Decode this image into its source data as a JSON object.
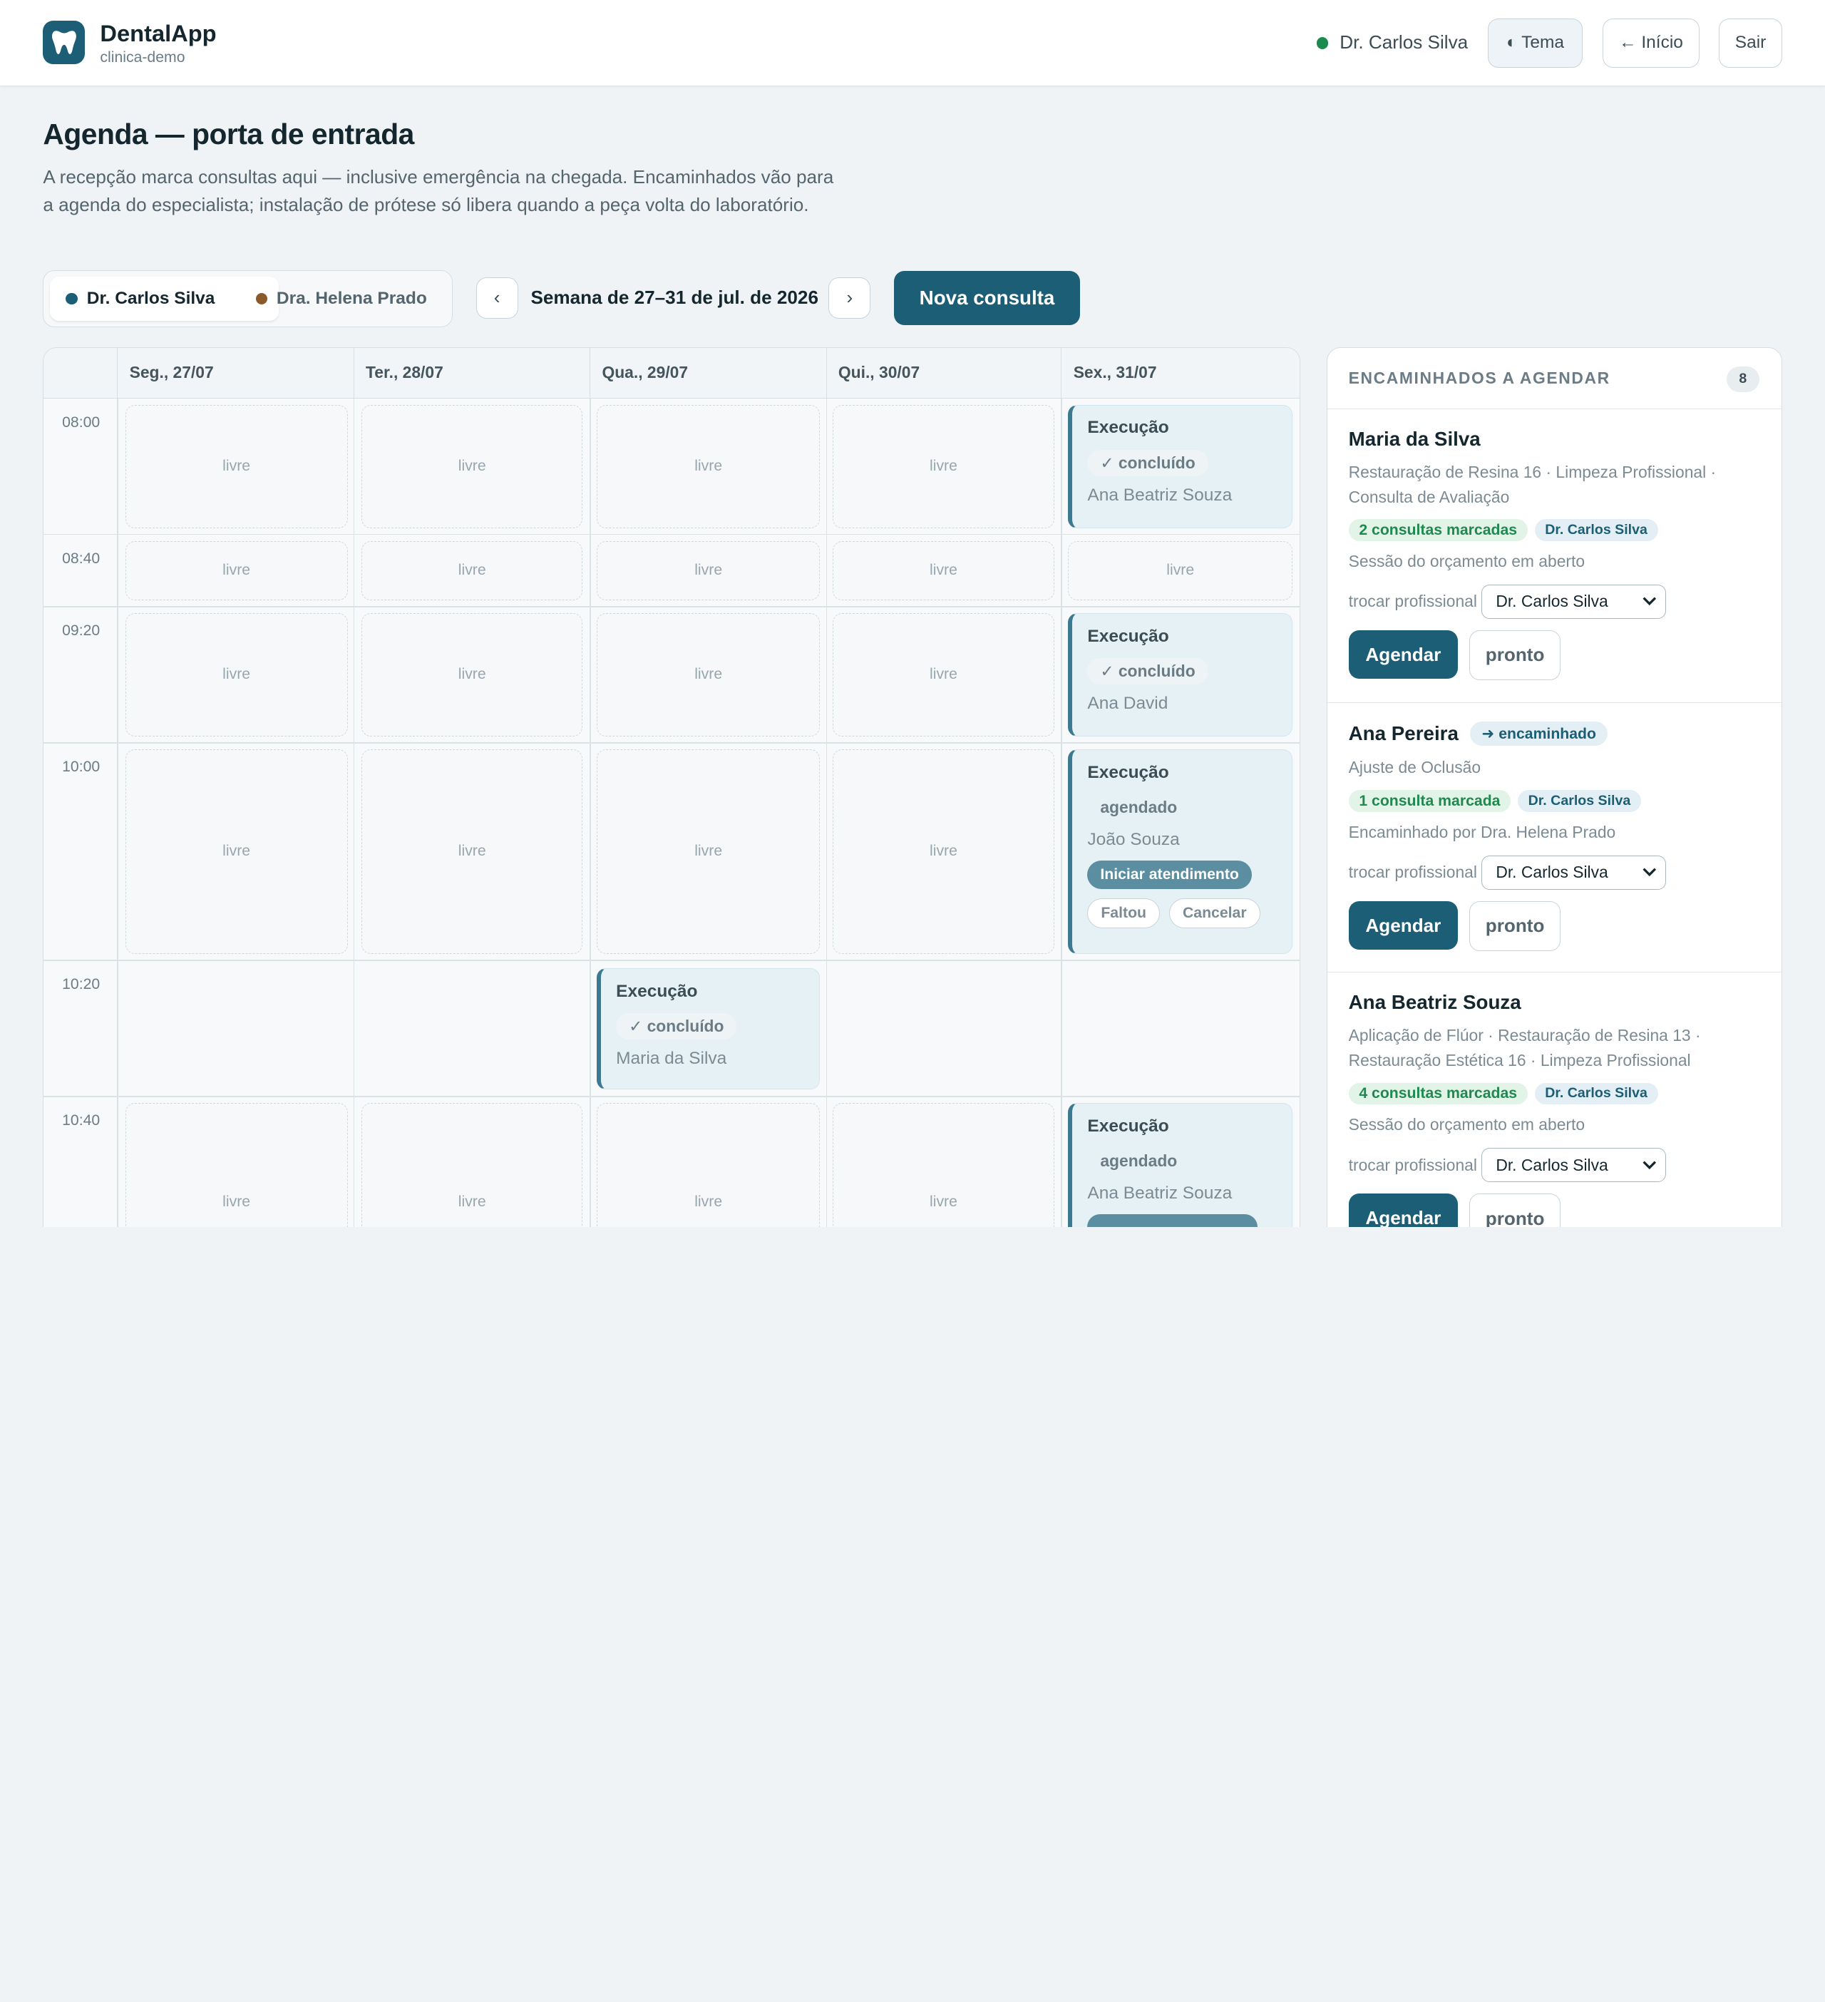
{
  "header": {
    "app_name": "DentalApp",
    "clinic": "clinica-demo",
    "user_name": "Dr. Carlos Silva",
    "theme_button": "◐ Tema",
    "home_button": "← Início",
    "logout_button": "Sair"
  },
  "intro": {
    "title": "Agenda — porta de entrada",
    "description": "A recepção marca consultas aqui — inclusive emergência na chegada. Encaminhados vão para a agenda do especialista; instalação de prótese só libera quando a peça volta do laboratório."
  },
  "controls": {
    "dentists": [
      {
        "name": "Dr. Carlos Silva",
        "color": "#1b5e75"
      },
      {
        "name": "Dra. Helena Prado",
        "color": "#8a5a2b"
      }
    ],
    "prev_icon": "‹",
    "next_icon": "›",
    "week_label": "Semana de 27–31 de jul. de 2026",
    "new_appointment": " Nova consulta"
  },
  "calendar": {
    "days": [
      "Seg., 27/07",
      "Ter., 28/07",
      "Qua., 29/07",
      "Qui., 30/07",
      "Sex., 31/07"
    ],
    "times": [
      "08:00",
      "08:40",
      "09:20",
      "10:00",
      "10:20",
      "10:40"
    ],
    "free_label": "livre",
    "appointments": [
      {
        "title": "Execução",
        "status": "✓ concluído",
        "patient": "Ana Beatriz Souza"
      },
      {
        "title": "Execução",
        "status": "✓ concluído",
        "patient": "Ana David"
      },
      {
        "title": "Execução",
        "status": "agendado",
        "patient": "João Souza",
        "start_button": "Iniciar atendimento",
        "no_show_button": "Faltou",
        "cancel_button": "Cancelar"
      },
      {
        "title": "Execução",
        "status": "✓ concluído",
        "patient": "Maria da Silva"
      },
      {
        "title": "Execução",
        "status": "agendado",
        "patient": "Ana Beatriz Souza"
      }
    ]
  },
  "panel": {
    "title": "ENCAMINHADOS A AGENDAR",
    "count": "8",
    "swap_label": "trocar profissional",
    "schedule_button": "Agendar",
    "ready_button": "pronto",
    "referrals": [
      {
        "name": "Maria da Silva",
        "tag": "",
        "procedures": "Restauração de Resina 16 · Limpeza Profissional · Consulta de Avaliação",
        "count_badge": "2 consultas marcadas",
        "dentist_badge": "Dr. Carlos Silva",
        "note": "Sessão do orçamento em aberto",
        "selected": "Dr. Carlos Silva"
      },
      {
        "name": "Ana Pereira",
        "tag": "➜ encaminhado",
        "procedures": "Ajuste de Oclusão",
        "count_badge": "1 consulta marcada",
        "dentist_badge": "Dr. Carlos Silva",
        "note": "Encaminhado por Dra. Helena Prado",
        "selected": "Dr. Carlos Silva"
      },
      {
        "name": "Ana Beatriz Souza",
        "tag": "",
        "procedures": "Aplicação de Flúor · Restauração de Resina 13 · Restauração Estética 16 · Limpeza Profissional",
        "count_badge": "4 consultas marcadas",
        "dentist_badge": "Dr. Carlos Silva",
        "note": "Sessão do orçamento em aberto",
        "selected": "Dr. Carlos Silva"
      }
    ]
  }
}
